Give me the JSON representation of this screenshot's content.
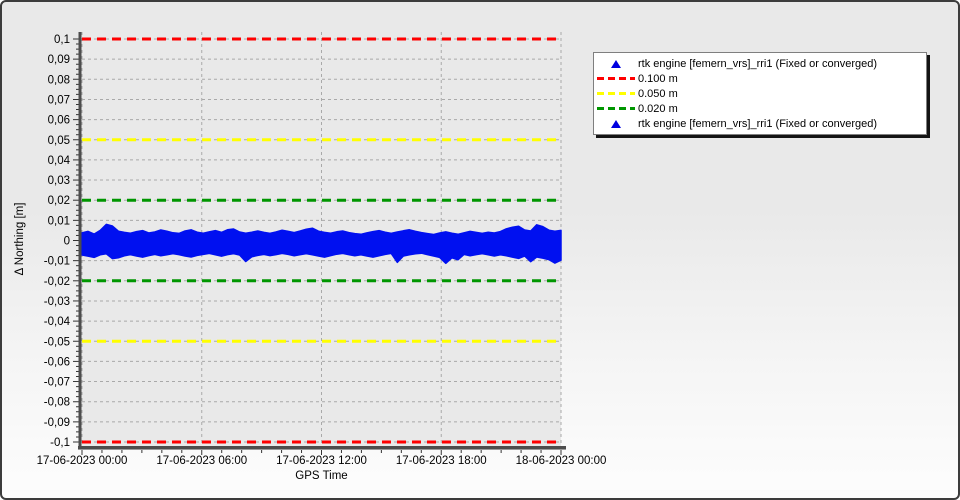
{
  "window": {
    "colors": {
      "bg_top": "#e9e9e9",
      "bg_bottom": "#fdfdfd",
      "border": "#3c3c3c",
      "plot_bg": "#e9e9e9",
      "grid": "#a9a9a9",
      "axis": "#4d4d4d",
      "tick": "#333333",
      "text": "#000000"
    }
  },
  "legend": {
    "items": [
      {
        "marker": "triangle",
        "color": "#0000e0",
        "label": "rtk engine [femern_vrs]_rri1 (Fixed or converged)"
      },
      {
        "marker": "dash",
        "color": "#ff0000",
        "label": "0.100 m"
      },
      {
        "marker": "dash",
        "color": "#ffff00",
        "label": "0.050 m"
      },
      {
        "marker": "dash",
        "color": "#009600",
        "label": "0.020 m"
      },
      {
        "marker": "triangle",
        "color": "#0000e0",
        "label": "rtk engine [femern_vrs]_rri1 (Fixed or converged)"
      }
    ]
  },
  "chart_data": {
    "type": "scatter",
    "title": "",
    "xlabel": "GPS Time",
    "ylabel": "Δ Northing [m]",
    "ylim": [
      -0.1,
      0.1
    ],
    "grid": true,
    "legend_position": "top-right",
    "x_ticks": [
      "17-06-2023 00:00",
      "17-06-2023 06:00",
      "17-06-2023 12:00",
      "17-06-2023 18:00",
      "18-06-2023 00:00"
    ],
    "y_tick_values": [
      0.1,
      0.09,
      0.08,
      0.07,
      0.06,
      0.05,
      0.04,
      0.03,
      0.02,
      0.01,
      0,
      -0.01,
      -0.02,
      -0.03,
      -0.04,
      -0.05,
      -0.06,
      -0.07,
      -0.08,
      -0.09,
      -0.1
    ],
    "y_tick_labels": [
      "0,1",
      "0,09",
      "0,08",
      "0,07",
      "0,06",
      "0,05",
      "0,04",
      "0,03",
      "0,02",
      "0,01",
      "0",
      "-0,01",
      "-0,02",
      "-0,03",
      "-0,04",
      "-0,05",
      "-0,06",
      "-0,07",
      "-0,08",
      "-0,09",
      "-0,1"
    ],
    "thresholds": [
      {
        "value": 0.1,
        "color": "#ff0000",
        "label": "0.100 m"
      },
      {
        "value": -0.1,
        "color": "#ff0000",
        "label": "0.100 m"
      },
      {
        "value": 0.05,
        "color": "#ffff00",
        "label": "0.050 m"
      },
      {
        "value": -0.05,
        "color": "#ffff00",
        "label": "0.050 m"
      },
      {
        "value": 0.02,
        "color": "#009600",
        "label": "0.020 m"
      },
      {
        "value": -0.02,
        "color": "#009600",
        "label": "0.020 m"
      }
    ],
    "series": [
      {
        "name": "rtk engine [femern_vrs]_rri1 (Fixed or converged)",
        "color": "#0010f0",
        "description": "Dense scatter band of Δ Northing residuals over 24 h, envelope given as upper/lower bounds in metres at evenly spaced times from 17-06-2023 00:00 to 18-06-2023 00:00",
        "band": {
          "upper": [
            0.0038,
            0.0045,
            0.0032,
            0.005,
            0.008,
            0.0072,
            0.0046,
            0.004,
            0.0036,
            0.0044,
            0.0049,
            0.0037,
            0.0042,
            0.0052,
            0.0046,
            0.0038,
            0.0035,
            0.0047,
            0.0053,
            0.0041,
            0.0036,
            0.0043,
            0.0049,
            0.004,
            0.0053,
            0.0057,
            0.0042,
            0.0036,
            0.0041,
            0.0047,
            0.004,
            0.0035,
            0.0042,
            0.0051,
            0.0045,
            0.0039,
            0.0047,
            0.0056,
            0.0061,
            0.0046,
            0.004,
            0.0036,
            0.0043,
            0.0047,
            0.0039,
            0.0034,
            0.0031,
            0.0038,
            0.0044,
            0.0049,
            0.0041,
            0.0035,
            0.0042,
            0.0048,
            0.0053,
            0.0045,
            0.0039,
            0.0034,
            0.003,
            0.0037,
            0.0043,
            0.0036,
            0.0031,
            0.0038,
            0.0045,
            0.004,
            0.0035,
            0.0041,
            0.0037,
            0.0044,
            0.0058,
            0.0066,
            0.0071,
            0.0052,
            0.0047,
            0.0078,
            0.0069,
            0.0051,
            0.0046,
            0.005
          ],
          "lower": [
            -0.0072,
            -0.0078,
            -0.0084,
            -0.0071,
            -0.0066,
            -0.009,
            -0.0086,
            -0.0076,
            -0.007,
            -0.0077,
            -0.0083,
            -0.0075,
            -0.0069,
            -0.0076,
            -0.0071,
            -0.0065,
            -0.007,
            -0.0077,
            -0.0082,
            -0.0074,
            -0.0069,
            -0.0064,
            -0.0071,
            -0.0078,
            -0.007,
            -0.0065,
            -0.0072,
            -0.0104,
            -0.0081,
            -0.0074,
            -0.0069,
            -0.0075,
            -0.007,
            -0.0064,
            -0.0069,
            -0.0076,
            -0.007,
            -0.0065,
            -0.0071,
            -0.0077,
            -0.0083,
            -0.0075,
            -0.0068,
            -0.0064,
            -0.007,
            -0.0076,
            -0.0071,
            -0.0077,
            -0.0083,
            -0.0076,
            -0.0069,
            -0.0064,
            -0.0108,
            -0.0077,
            -0.0071,
            -0.0066,
            -0.0063,
            -0.007,
            -0.0077,
            -0.0084,
            -0.0113,
            -0.0086,
            -0.0096,
            -0.0069,
            -0.0076,
            -0.007,
            -0.0065,
            -0.0071,
            -0.0077,
            -0.0071,
            -0.0076,
            -0.0083,
            -0.0089,
            -0.0077,
            -0.0105,
            -0.0082,
            -0.0088,
            -0.0095,
            -0.0112,
            -0.0098
          ]
        }
      }
    ]
  }
}
